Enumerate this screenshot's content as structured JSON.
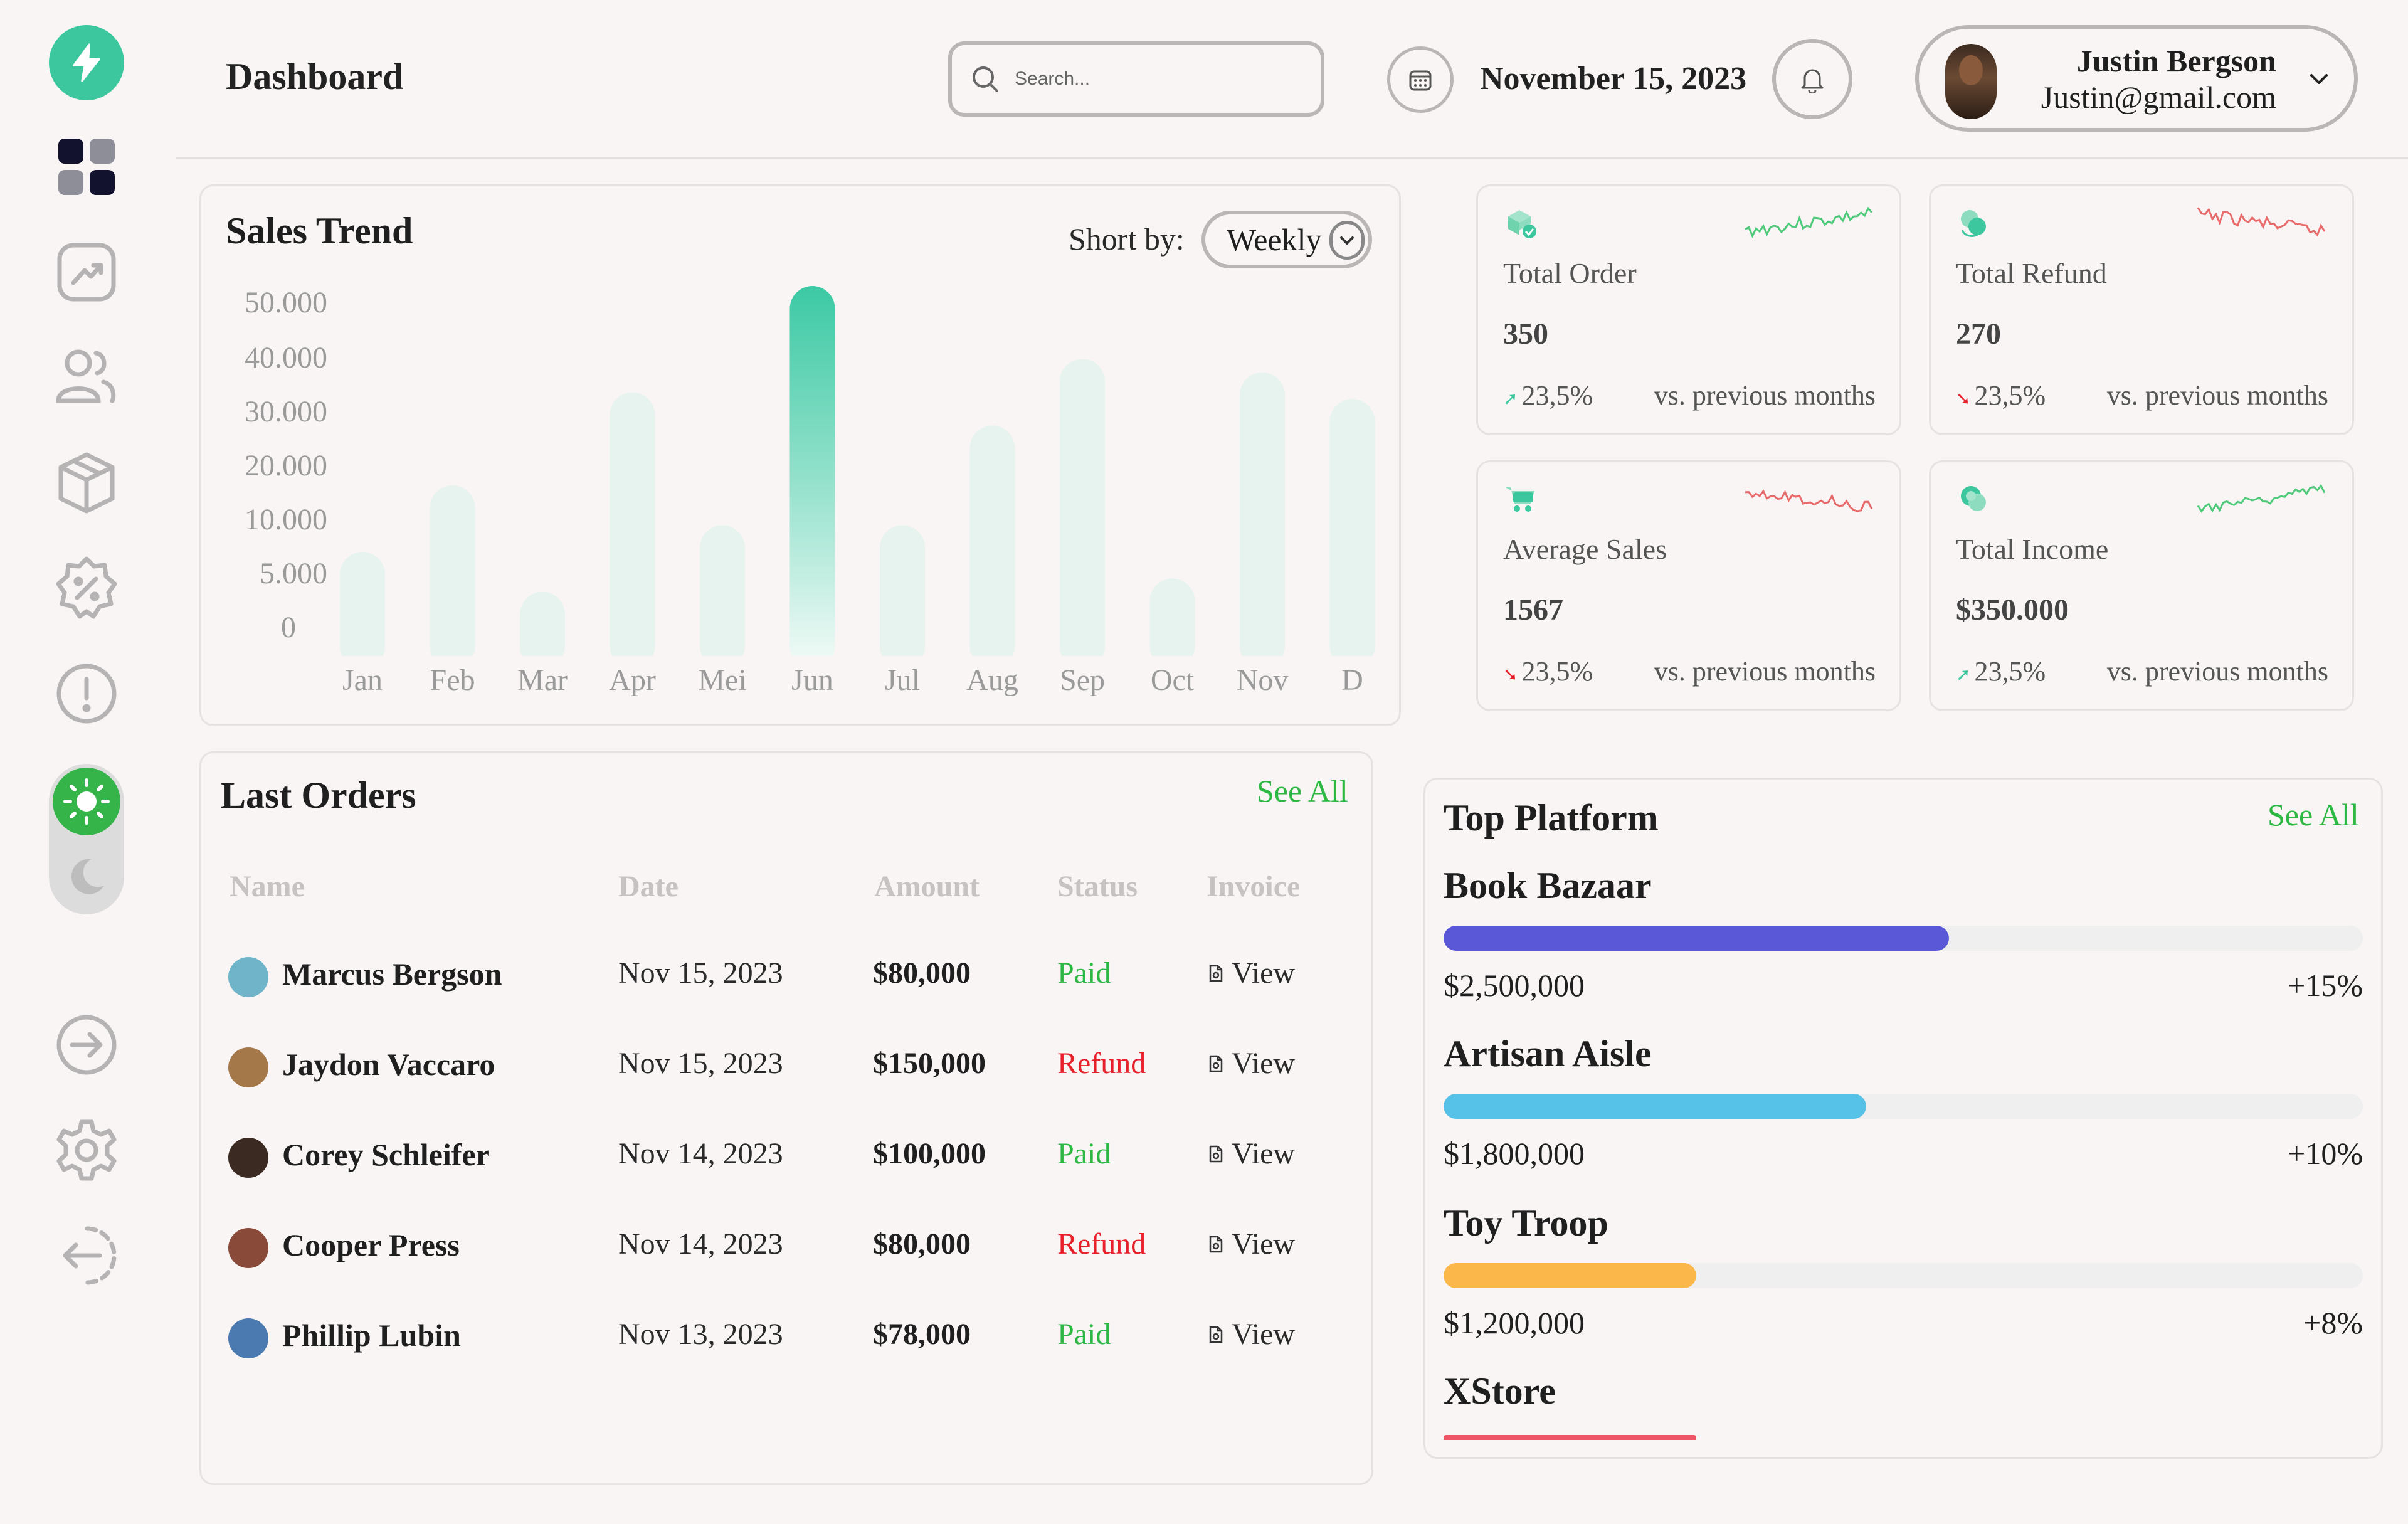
{
  "colors": {
    "accent": "#3cc79e",
    "green": "#2db843",
    "red": "#e8202a",
    "chart_bar": "#e6f3ee",
    "chart_highlight": "#3cc9a4"
  },
  "sidebar": {
    "items": [
      {
        "name": "dashboard-grid-icon",
        "active": true
      },
      {
        "name": "analytics-icon"
      },
      {
        "name": "users-icon"
      },
      {
        "name": "product-box-icon"
      },
      {
        "name": "discount-badge-icon"
      },
      {
        "name": "alert-icon"
      }
    ],
    "bottom_items": [
      {
        "name": "forward-arrow-icon"
      },
      {
        "name": "settings-gear-icon"
      },
      {
        "name": "logout-icon"
      }
    ],
    "theme": {
      "selected": "light"
    }
  },
  "header": {
    "title": "Dashboard",
    "search_placeholder": "Search...",
    "date": "November 15, 2023",
    "user": {
      "name": "Justin Bergson",
      "email": "Justin@gmail.com"
    }
  },
  "sales_trend": {
    "title": "Sales Trend",
    "sort_label": "Short by:",
    "sort_value": "Weekly"
  },
  "chart_data": {
    "type": "bar",
    "title": "Sales Trend",
    "categories": [
      "Jan",
      "Feb",
      "Mar",
      "Apr",
      "Mei",
      "Jun",
      "Jul",
      "Aug",
      "Sep",
      "Oct",
      "Nov",
      "D"
    ],
    "values": [
      10000,
      20000,
      4000,
      34000,
      14000,
      50000,
      14000,
      29000,
      39000,
      6000,
      37000,
      33000
    ],
    "highlight_index": 5,
    "y_ticks": [
      "0",
      "5.000",
      "10.000",
      "20.000",
      "30.000",
      "40.000",
      "50.000"
    ],
    "grid": false,
    "xlabel": "",
    "ylabel": ""
  },
  "stats": [
    {
      "label": "Total Order",
      "value": "350",
      "change": "23,5%",
      "trend": "up",
      "compare": "vs. previous months",
      "icon": "box-check-icon",
      "spark_color": "#4fc97a"
    },
    {
      "label": "Total Refund",
      "value": "270",
      "change": "23,5%",
      "trend": "down",
      "compare": "vs. previous months",
      "icon": "refund-icon",
      "spark_color": "#e86a6a"
    },
    {
      "label": "Average Sales",
      "value": "1567",
      "change": "23,5%",
      "trend": "down",
      "compare": "vs. previous months",
      "icon": "cart-icon",
      "spark_color": "#e86a6a"
    },
    {
      "label": "Total Income",
      "value": "$350.000",
      "change": "23,5%",
      "trend": "up",
      "compare": "vs. previous months",
      "icon": "coins-icon",
      "spark_color": "#4fc97a"
    }
  ],
  "orders": {
    "title": "Last Orders",
    "see_all": "See All",
    "columns": [
      "Name",
      "Date",
      "Amount",
      "Status",
      "Invoice"
    ],
    "rows": [
      {
        "name": "Marcus Bergson",
        "date": "Nov 15, 2023",
        "amount": "$80,000",
        "status": "Paid",
        "invoice": "View",
        "avatar_color": "#6fb4c9"
      },
      {
        "name": "Jaydon Vaccaro",
        "date": "Nov 15, 2023",
        "amount": "$150,000",
        "status": "Refund",
        "invoice": "View",
        "avatar_color": "#a5784a"
      },
      {
        "name": "Corey Schleifer",
        "date": "Nov 14, 2023",
        "amount": "$100,000",
        "status": "Paid",
        "invoice": "View",
        "avatar_color": "#3a2a22"
      },
      {
        "name": "Cooper Press",
        "date": "Nov 14, 2023",
        "amount": "$80,000",
        "status": "Refund",
        "invoice": "View",
        "avatar_color": "#8a4a3a"
      },
      {
        "name": "Phillip Lubin",
        "date": "Nov 13, 2023",
        "amount": "$78,000",
        "status": "Paid",
        "invoice": "View",
        "avatar_color": "#4a7ab0"
      }
    ]
  },
  "platforms": {
    "title": "Top Platform",
    "see_all": "See All",
    "items": [
      {
        "name": "Book Bazaar",
        "amount": "$2,500,000",
        "change": "+15%",
        "share": 0.55,
        "color": "#5b58d8"
      },
      {
        "name": "Artisan Aisle",
        "amount": "$1,800,000",
        "change": "+10%",
        "share": 0.46,
        "color": "#56c2e8"
      },
      {
        "name": "Toy Troop",
        "amount": "$1,200,000",
        "change": "+8%",
        "share": 0.275,
        "color": "#fcb74a"
      },
      {
        "name": "XStore",
        "amount": "",
        "change": "",
        "share": 0.275,
        "color": "#ee5566"
      }
    ]
  }
}
